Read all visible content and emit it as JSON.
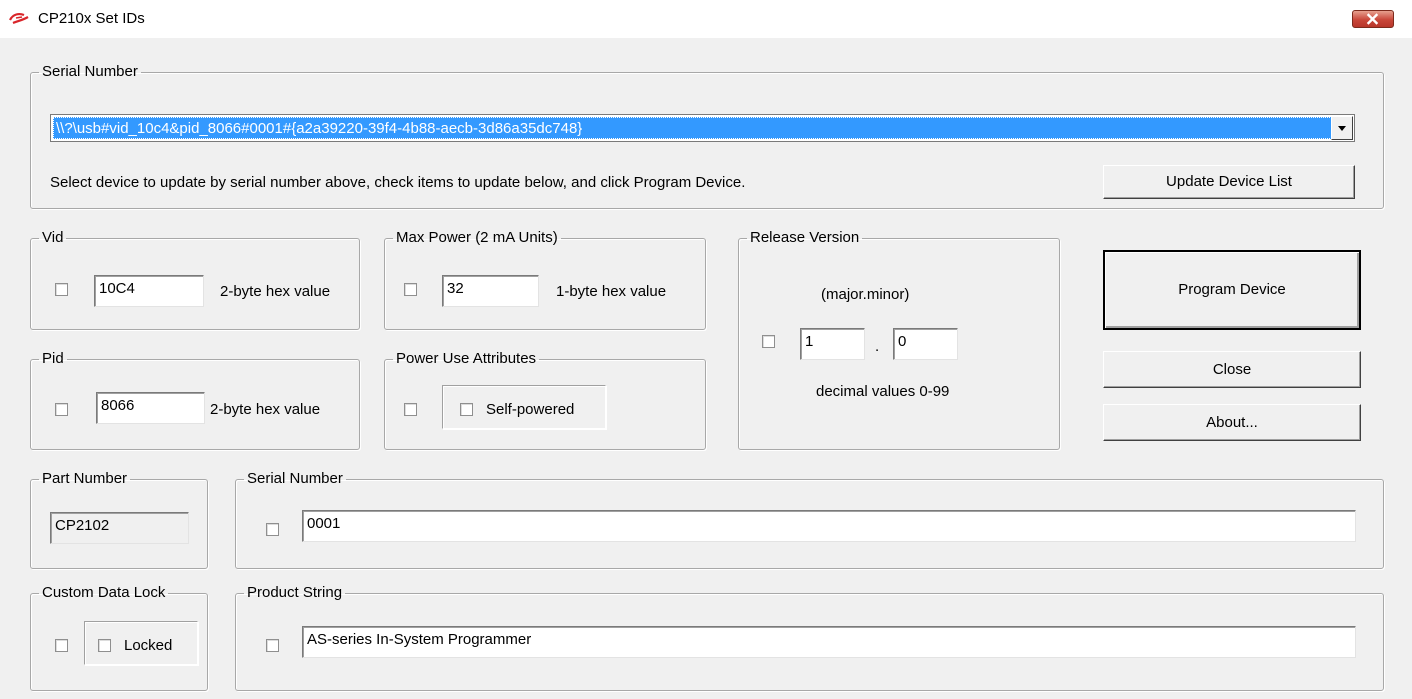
{
  "window": {
    "title": "CP210x Set IDs",
    "close_icon": "close-icon"
  },
  "serial_group": {
    "legend": "Serial Number",
    "selected_device": "\\\\?\\usb#vid_10c4&pid_8066#0001#{a2a39220-39f4-4b88-aecb-3d86a35dc748}",
    "instructions": "Select device to update by serial number above, check items to update below, and click Program Device.",
    "update_button": "Update Device List"
  },
  "vid": {
    "legend": "Vid",
    "value": "10C4",
    "hint": "2-byte hex value",
    "checked": false
  },
  "pid": {
    "legend": "Pid",
    "value": "8066",
    "hint": "2-byte hex value",
    "checked": false
  },
  "max_power": {
    "legend": "Max Power (2 mA Units)",
    "value": "32",
    "hint": "1-byte hex value",
    "checked": false
  },
  "power_attrs": {
    "legend": "Power Use Attributes",
    "self_powered_label": "Self-powered",
    "checked": false,
    "self_powered": false
  },
  "release": {
    "legend": "Release Version",
    "format": "(major.minor)",
    "major": "1",
    "separator": ".",
    "minor": "0",
    "hint": "decimal values 0-99",
    "checked": false
  },
  "buttons": {
    "program": "Program Device",
    "close": "Close",
    "about": "About..."
  },
  "part_number": {
    "legend": "Part Number",
    "value": "CP2102"
  },
  "serial_number": {
    "legend": "Serial Number",
    "value": "0001",
    "checked": false
  },
  "custom_lock": {
    "legend": "Custom Data Lock",
    "locked_label": "Locked",
    "checked": false,
    "locked": false
  },
  "product_string": {
    "legend": "Product String",
    "value": "AS-series In-System Programmer",
    "checked": false
  },
  "colors": {
    "selection": "#3399ff",
    "dialog_bg": "#f0f0f0",
    "close_button": "#c9473a",
    "logo": "#d9252a"
  }
}
